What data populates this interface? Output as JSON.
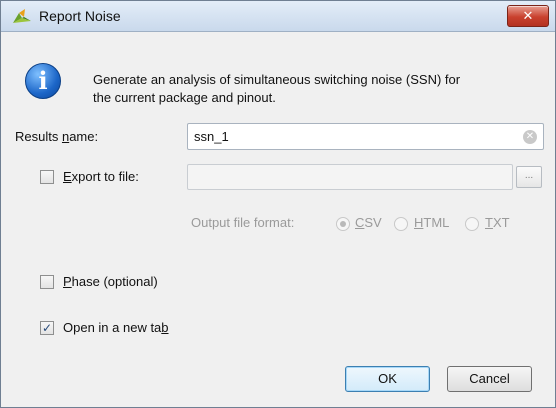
{
  "window": {
    "title": "Report Noise",
    "close_glyph": "✕",
    "app_icon": "vivado-leaf-icon"
  },
  "info": {
    "icon": "info-icon",
    "line1": "Generate an analysis of simultaneous switching noise (SSN) for",
    "line2": "the current package and pinout."
  },
  "results_name": {
    "label_pre": "Results ",
    "label_mnemonic": "n",
    "label_post": "ame:",
    "value": "ssn_1"
  },
  "export": {
    "checked": false,
    "label_pre": "",
    "label_mnemonic": "E",
    "label_post": "xport to file:",
    "value": "",
    "browse_label": "..."
  },
  "output_format": {
    "label": "Output file format:",
    "options": [
      {
        "pre": "",
        "mnemonic": "C",
        "post": "SV",
        "selected": true
      },
      {
        "pre": "",
        "mnemonic": "H",
        "post": "TML",
        "selected": false
      },
      {
        "pre": "",
        "mnemonic": "T",
        "post": "XT",
        "selected": false
      }
    ]
  },
  "phase": {
    "checked": false,
    "label_pre": "",
    "label_mnemonic": "P",
    "label_post": "hase (optional)"
  },
  "open_new_tab": {
    "checked": true,
    "label_pre": "Open in a new ta",
    "label_mnemonic": "b",
    "label_post": ""
  },
  "buttons": {
    "ok": "OK",
    "cancel": "Cancel"
  },
  "colors": {
    "titlebar_top": "#e3edf8",
    "titlebar_bottom": "#c9d9ec",
    "close_red": "#c9412e",
    "dialog_bg": "#f0f0f0"
  }
}
